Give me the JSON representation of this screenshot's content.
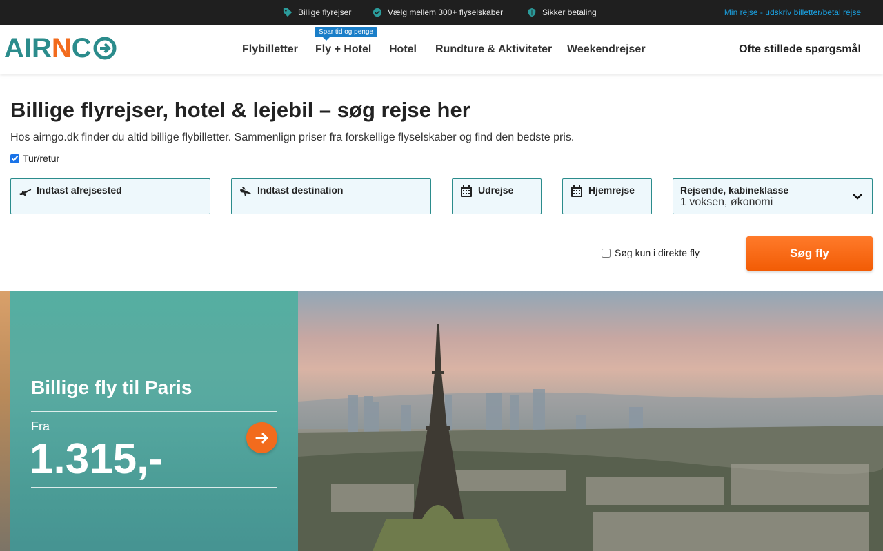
{
  "topbar": {
    "usps": [
      {
        "icon": "tag-icon",
        "label": "Billige flyrejser"
      },
      {
        "icon": "check-circle-icon",
        "label": "Vælg mellem 300+ flyselskaber"
      },
      {
        "icon": "shield-icon",
        "label": "Sikker betaling"
      }
    ],
    "my_trip": "Min rejse - udskriv billetter/betal rejse"
  },
  "header": {
    "logo": {
      "part1": "AIR",
      "part2": "N",
      "part3": "C"
    },
    "nav": [
      "Flybilletter",
      "Fly + Hotel",
      "Hotel",
      "Rundture & Aktiviteter",
      "Weekendrejser"
    ],
    "badge": "Spar tid og penge",
    "faq": "Ofte stillede spørgsmål"
  },
  "search": {
    "title": "Billige flyrejser, hotel & lejebil – søg rejse her",
    "subtitle": "Hos airngo.dk finder du altid billige flybilletter. Sammenlign priser fra forskellige flyselskaber og find den bedste pris.",
    "roundtrip_label": "Tur/retur",
    "roundtrip_checked": true,
    "origin_placeholder": "Indtast afrejsested",
    "destination_placeholder": "Indtast destination",
    "depart_label": "Udrejse",
    "return_label": "Hjemrejse",
    "travellers_label": "Rejsende, kabineklasse",
    "travellers_value": "1 voksen, økonomi",
    "direct_label": "Søg kun i direkte fly",
    "direct_checked": false,
    "search_button": "Søg fly"
  },
  "promo": {
    "title": "Billige fly til Paris",
    "from_label": "Fra",
    "price": "1.315,-"
  },
  "colors": {
    "brand_teal": "#2b8c8c",
    "brand_orange": "#f26b1d",
    "link_blue": "#1aa0e0",
    "badge_blue": "#1a7ec8",
    "topbar_bg": "#1f1f1f",
    "field_bg": "#eef8fc"
  }
}
